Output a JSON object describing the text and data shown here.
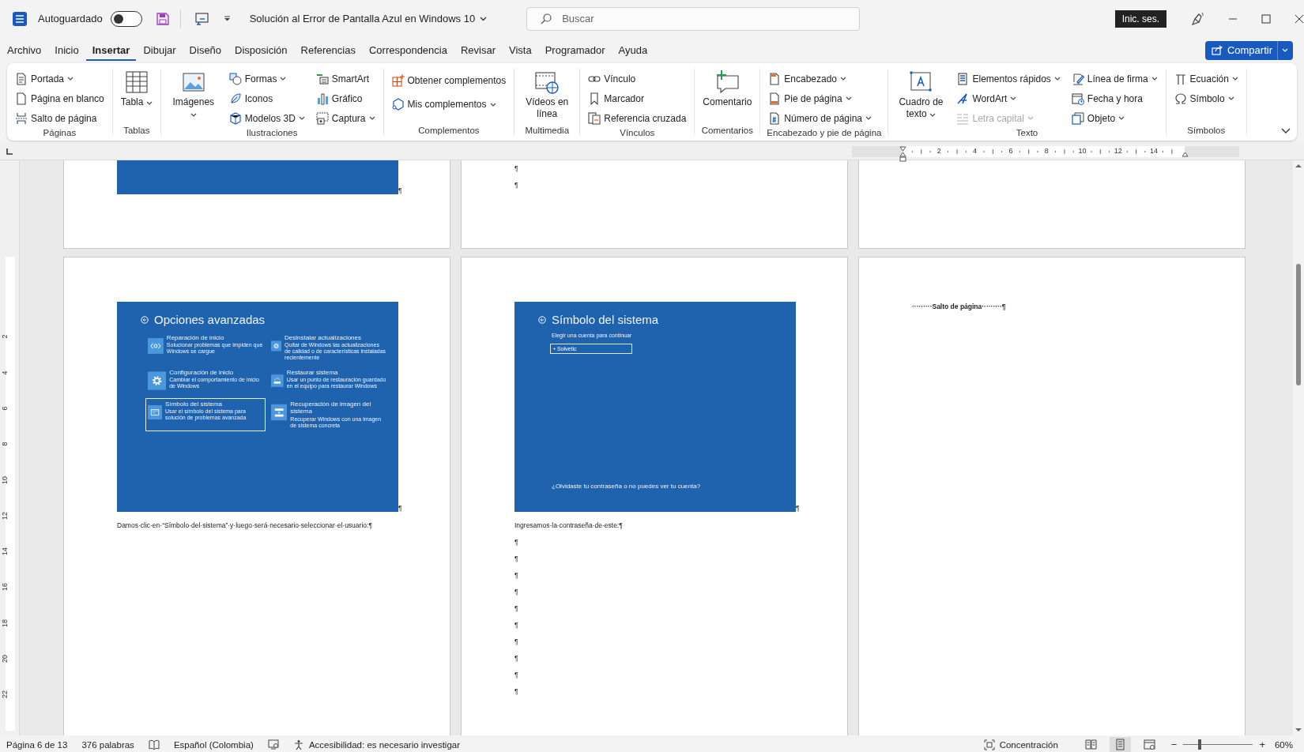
{
  "title_bar": {
    "autosave_label": "Autoguardado",
    "autosave_on": false,
    "document_title": "Solución al Error de Pantalla Azul en Windows 10",
    "search": {
      "placeholder": "Buscar"
    },
    "sign_in": "Inic. ses."
  },
  "tabs": [
    {
      "label": "Archivo",
      "selected": false
    },
    {
      "label": "Inicio",
      "selected": false
    },
    {
      "label": "Insertar",
      "selected": true
    },
    {
      "label": "Dibujar",
      "selected": false
    },
    {
      "label": "Diseño",
      "selected": false
    },
    {
      "label": "Disposición",
      "selected": false
    },
    {
      "label": "Referencias",
      "selected": false
    },
    {
      "label": "Correspondencia",
      "selected": false
    },
    {
      "label": "Revisar",
      "selected": false
    },
    {
      "label": "Vista",
      "selected": false
    },
    {
      "label": "Programador",
      "selected": false
    },
    {
      "label": "Ayuda",
      "selected": false
    }
  ],
  "share_button": "Compartir",
  "ribbon": {
    "groups": [
      {
        "label": "Páginas",
        "columns": [
          [
            {
              "label": "Portada",
              "dropdown": true,
              "disabled": false
            },
            {
              "label": "Página en blanco",
              "dropdown": false,
              "disabled": false
            },
            {
              "label": "Salto de página",
              "dropdown": false,
              "disabled": false
            }
          ]
        ]
      },
      {
        "label": "Tablas",
        "columns": [
          [
            {
              "label": "Tabla",
              "dropdown": true,
              "disabled": false,
              "kind": "large"
            }
          ]
        ]
      },
      {
        "label": "Ilustraciones",
        "columns": [
          [
            {
              "label": "Imágenes",
              "dropdown": true,
              "disabled": false,
              "kind": "large"
            }
          ],
          [
            {
              "label": "Formas",
              "dropdown": true,
              "disabled": false
            },
            {
              "label": "Iconos",
              "dropdown": false,
              "disabled": false
            },
            {
              "label": "Modelos 3D",
              "dropdown": true,
              "disabled": false
            }
          ],
          [
            {
              "label": "SmartArt",
              "dropdown": false,
              "disabled": false
            },
            {
              "label": "Gráfico",
              "dropdown": false,
              "disabled": false
            },
            {
              "label": "Captura",
              "dropdown": true,
              "disabled": false
            }
          ]
        ]
      },
      {
        "label": "Complementos",
        "columns": [
          [
            {
              "label": "Obtener complementos",
              "dropdown": false,
              "disabled": false,
              "kind": "wide"
            },
            {
              "label": "Mis complementos",
              "dropdown": true,
              "disabled": false,
              "kind": "wide"
            }
          ]
        ]
      },
      {
        "label": "Multimedia",
        "columns": [
          [
            {
              "label": "Vídeos en línea",
              "dropdown": false,
              "disabled": false,
              "kind": "large"
            }
          ]
        ]
      },
      {
        "label": "Vínculos",
        "columns": [
          [
            {
              "label": "Vínculo",
              "dropdown": false,
              "disabled": false
            },
            {
              "label": "Marcador",
              "dropdown": false,
              "disabled": false
            },
            {
              "label": "Referencia cruzada",
              "dropdown": false,
              "disabled": false
            }
          ]
        ]
      },
      {
        "label": "Comentarios",
        "columns": [
          [
            {
              "label": "Comentario",
              "dropdown": false,
              "disabled": false,
              "kind": "large"
            }
          ]
        ]
      },
      {
        "label": "Encabezado y pie de página",
        "columns": [
          [
            {
              "label": "Encabezado",
              "dropdown": true,
              "disabled": false
            },
            {
              "label": "Pie de página",
              "dropdown": true,
              "disabled": false
            },
            {
              "label": "Número de página",
              "dropdown": true,
              "disabled": false
            }
          ]
        ]
      },
      {
        "label": "Texto",
        "columns": [
          [
            {
              "label": "Cuadro de texto",
              "dropdown": true,
              "disabled": false,
              "kind": "large"
            }
          ],
          [
            {
              "label": "Elementos rápidos",
              "dropdown": true,
              "disabled": false
            },
            {
              "label": "WordArt",
              "dropdown": true,
              "disabled": false
            },
            {
              "label": "Letra capital",
              "dropdown": true,
              "disabled": true
            }
          ],
          [
            {
              "label": "Línea de firma",
              "dropdown": true,
              "disabled": false
            },
            {
              "label": "Fecha y hora",
              "dropdown": false,
              "disabled": false
            },
            {
              "label": "Objeto",
              "dropdown": true,
              "disabled": false
            }
          ]
        ]
      },
      {
        "label": "Símbolos",
        "columns": [
          [
            {
              "label": "Ecuación",
              "dropdown": true,
              "disabled": false
            },
            {
              "label": "Símbolo",
              "dropdown": true,
              "disabled": false
            }
          ]
        ]
      }
    ]
  },
  "ruler": {
    "numbers": [
      "2",
      "4",
      "6",
      "8",
      "10",
      "12",
      "14"
    ]
  },
  "vertical_ruler": {
    "numbers": [
      "2",
      "4",
      "6",
      "8",
      "10",
      "12",
      "14",
      "16",
      "18",
      "20",
      "22"
    ]
  },
  "page_rows": [
    {
      "pages": [
        {
          "blocks": [
            {
              "kind": "image",
              "mark": "¶"
            }
          ]
        },
        {
          "blocks": [
            {
              "kind": "paragraph",
              "text": "¶"
            },
            {
              "kind": "paragraph",
              "text": "¶"
            }
          ]
        }
      ]
    },
    {
      "pages": [
        {
          "blocks": [
            {
              "kind": "image",
              "mark": "¶",
              "screen": {
                "kind": "options",
                "title": "Opciones avanzadas",
                "options": [
                  {
                    "title": "Reparación de inicio",
                    "description": "Solucionar problemas que impiden que Windows se cargue",
                    "selected": false
                  },
                  {
                    "title": "Desinstalar actualizaciones",
                    "description": "Quitar de Windows las actualizaciones de calidad o de características instaladas recientemente",
                    "selected": false
                  },
                  {
                    "title": "Configuración de inicio",
                    "description": "Cambiar el comportamiento de inicio de Windows",
                    "selected": false
                  },
                  {
                    "title": "Restaurar sistema",
                    "description": "Usar un punto de restauración guardado en el equipo para restaurar Windows",
                    "selected": false
                  },
                  {
                    "title": "Símbolo del sistema",
                    "description": "Usar el símbolo del sistema para solución de problemas avanzada",
                    "selected": true
                  },
                  {
                    "title": "Recuperación de imagen del sistema",
                    "description": "Recuperar Windows con una imagen de sistema concreta",
                    "selected": false
                  }
                ]
              }
            },
            {
              "kind": "paragraph",
              "text": "Damos·clic·en·“Símbolo·del·sistema”·y·luego·será·necesario·seleccionar·el·usuario:¶"
            }
          ]
        },
        {
          "blocks": [
            {
              "kind": "image",
              "mark": "¶",
              "screen": {
                "kind": "account",
                "title": "Símbolo del sistema",
                "prompt": "Elegir una cuenta para continuar",
                "account": "Solvetic",
                "link": "¿Olvidaste tu contraseña o no puedes ver tu cuenta?"
              }
            },
            {
              "kind": "paragraph",
              "text": "Ingresamos·la·contraseña·de·este:¶"
            },
            {
              "kind": "paragraph",
              "text": "¶"
            },
            {
              "kind": "paragraph",
              "text": "¶"
            },
            {
              "kind": "paragraph",
              "text": "¶"
            },
            {
              "kind": "paragraph",
              "text": "¶"
            },
            {
              "kind": "paragraph",
              "text": "¶"
            },
            {
              "kind": "paragraph",
              "text": "¶"
            },
            {
              "kind": "paragraph",
              "text": "¶"
            },
            {
              "kind": "paragraph",
              "text": "¶"
            },
            {
              "kind": "paragraph",
              "text": "¶"
            },
            {
              "kind": "paragraph",
              "text": "¶"
            }
          ]
        },
        {
          "blocks": [
            {
              "kind": "page_break",
              "text": "·········Salto de página·········¶"
            }
          ]
        }
      ]
    }
  ],
  "status_bar": {
    "page": "Página 6 de 13",
    "words": "376 palabras",
    "language": "Español (Colombia)",
    "accessibility": "Accesibilidad: es necesario investigar",
    "focus": "Concentración",
    "views": [
      {
        "selected": false
      },
      {
        "selected": true
      },
      {
        "selected": false
      }
    ],
    "zoom_out": "−",
    "zoom": {
      "level": 0.23
    },
    "zoom_in": "+",
    "zoom_reading": "60%"
  }
}
